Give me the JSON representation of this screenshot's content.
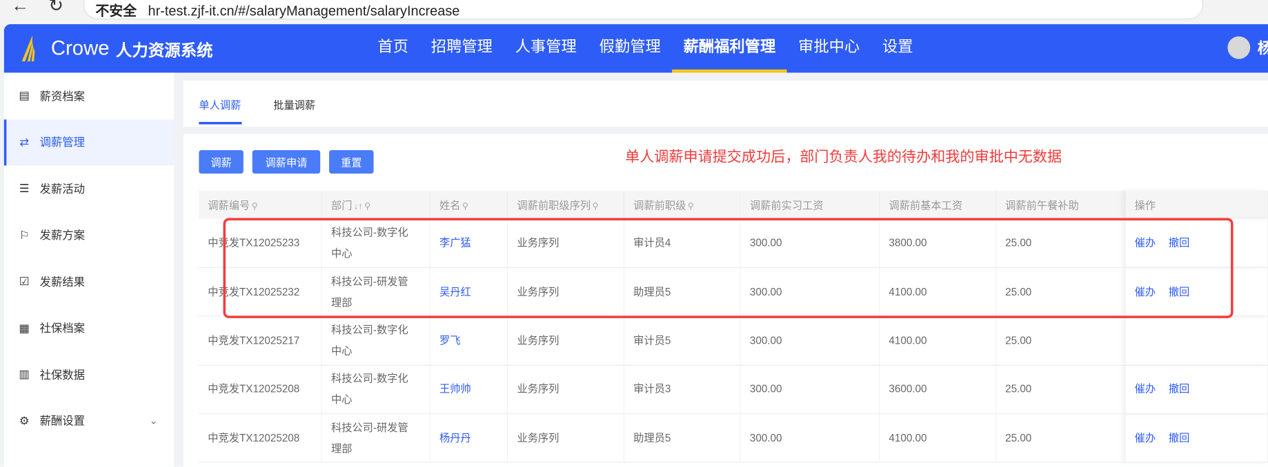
{
  "browser": {
    "security": "不安全",
    "url": "hr-test.zjf-it.cn/#/salaryManagement/salaryIncrease"
  },
  "header": {
    "brand": "Crowe",
    "system": "人力资源系统",
    "menu": [
      "首页",
      "招聘管理",
      "人事管理",
      "假勤管理",
      "薪酬福利管理",
      "审批中心",
      "设置"
    ],
    "active_menu": "薪酬福利管理",
    "user": "杨"
  },
  "sidebar": {
    "items": [
      {
        "label": "薪资档案",
        "icon": "document-icon"
      },
      {
        "label": "调薪管理",
        "icon": "exchange-icon"
      },
      {
        "label": "发薪活动",
        "icon": "list-icon"
      },
      {
        "label": "发薪方案",
        "icon": "flag-icon"
      },
      {
        "label": "发薪结果",
        "icon": "check-clipboard-icon"
      },
      {
        "label": "社保档案",
        "icon": "grid-icon"
      },
      {
        "label": "社保数据",
        "icon": "bar-chart-icon"
      },
      {
        "label": "薪酬设置",
        "icon": "gear-icon"
      }
    ],
    "active": "调薪管理"
  },
  "tabs": [
    "单人调薪",
    "批量调薪"
  ],
  "toolbar": {
    "adjust": "调薪",
    "apply": "调薪申请",
    "reset": "重置"
  },
  "annotation": "单人调薪申请提交成功后，部门负责人我的待办和我的审批中无数据",
  "table": {
    "columns": [
      "调薪编号",
      "部门",
      "姓名",
      "调薪前职级序列",
      "调薪前职级",
      "调薪前实习工资",
      "调薪前基本工资",
      "调薪前午餐补助",
      "操作"
    ],
    "rows": [
      {
        "id": "中竞发TX12025233",
        "dept": "科技公司-数字化中心",
        "name": "李广猛",
        "seq": "业务序列",
        "level": "审计员4",
        "intern": "300.00",
        "base": "3800.00",
        "lunch": "25.00",
        "actions": [
          "催办",
          "撤回"
        ]
      },
      {
        "id": "中竞发TX12025232",
        "dept": "科技公司-研发管理部",
        "name": "吴丹红",
        "seq": "业务序列",
        "level": "助理员5",
        "intern": "300.00",
        "base": "4100.00",
        "lunch": "25.00",
        "actions": [
          "催办",
          "撤回"
        ]
      },
      {
        "id": "中竞发TX12025217",
        "dept": "科技公司-数字化中心",
        "name": "罗飞",
        "seq": "业务序列",
        "level": "审计员5",
        "intern": "300.00",
        "base": "4100.00",
        "lunch": "25.00",
        "actions": []
      },
      {
        "id": "中竞发TX12025208",
        "dept": "科技公司-数字化中心",
        "name": "王帅帅",
        "seq": "业务序列",
        "level": "审计员3",
        "intern": "300.00",
        "base": "3600.00",
        "lunch": "25.00",
        "actions": [
          "催办",
          "撤回"
        ]
      },
      {
        "id": "中竞发TX12025208",
        "dept": "科技公司-研发管理部",
        "name": "杨丹丹",
        "seq": "业务序列",
        "level": "助理员5",
        "intern": "300.00",
        "base": "4100.00",
        "lunch": "25.00",
        "actions": [
          "催办",
          "撤回"
        ]
      }
    ]
  },
  "colors": {
    "primary": "#2e5cf6",
    "accent": "#f5c518",
    "annotation": "#f03a3a"
  }
}
